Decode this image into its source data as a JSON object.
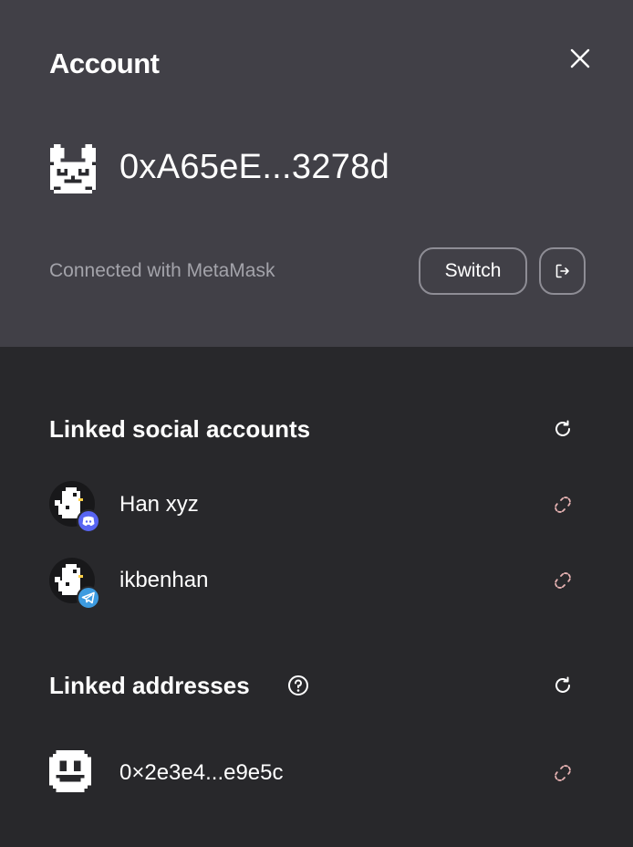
{
  "header": {
    "title": "Account",
    "close_icon": "close-icon"
  },
  "wallet": {
    "avatar_icon": "pixel-bunny-avatar",
    "address": "0xA65eE...3278d",
    "connected_with": "Connected with MetaMask",
    "switch_label": "Switch",
    "logout_icon": "logout-icon"
  },
  "social": {
    "title": "Linked social accounts",
    "refresh_icon": "refresh-icon",
    "accounts": [
      {
        "name": "Han xyz",
        "platform": "discord",
        "badge_color": "#5865F2",
        "unlink_icon": "unlink-icon"
      },
      {
        "name": "ikbenhan",
        "platform": "telegram",
        "badge_color": "#3d9be0",
        "unlink_icon": "unlink-icon"
      }
    ]
  },
  "addresses": {
    "title": "Linked addresses",
    "help_icon": "help-icon",
    "refresh_icon": "refresh-icon",
    "items": [
      {
        "address": "0×2e3e4...e9e5c",
        "avatar_icon": "pixel-smiley-avatar",
        "unlink_icon": "unlink-icon"
      }
    ]
  },
  "colors": {
    "top_panel": "#414047",
    "bottom_panel": "#28282b",
    "unlink_accent": "#e8b4b4"
  }
}
